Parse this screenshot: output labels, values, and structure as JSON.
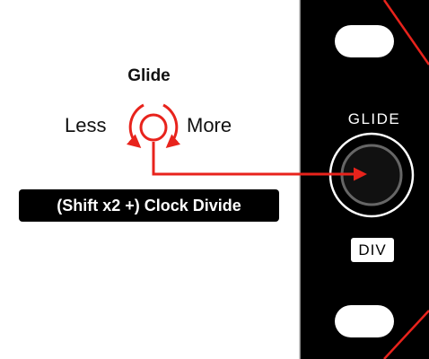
{
  "knob_title": "Glide",
  "direction_left": "Less",
  "direction_right": "More",
  "shift_function": "(Shift x2 +) Clock Divide",
  "panel": {
    "knob_label": "GLIDE",
    "badge_label": "DIV"
  },
  "colors": {
    "accent": "#e8231c",
    "panel": "#000000",
    "text": "#111111"
  }
}
